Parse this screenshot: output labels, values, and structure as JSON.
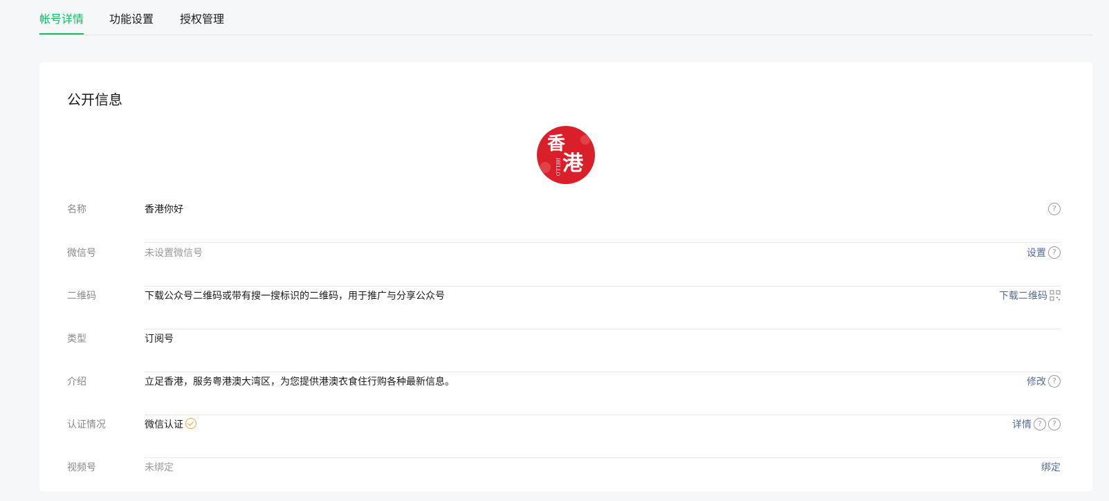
{
  "tabs": [
    {
      "label": "帐号详情"
    },
    {
      "label": "功能设置"
    },
    {
      "label": "授权管理"
    }
  ],
  "section": {
    "title": "公开信息",
    "avatar_text_top": "香",
    "avatar_text_bottom": "港",
    "avatar_text_side": "HELLO"
  },
  "rows": {
    "name": {
      "label": "名称",
      "value": "香港你好"
    },
    "wechat_id": {
      "label": "微信号",
      "value": "未设置微信号",
      "action": "设置"
    },
    "qrcode": {
      "label": "二维码",
      "value": "下载公众号二维码或带有搜一搜标识的二维码，用于推广与分享公众号",
      "action": "下载二维码"
    },
    "type": {
      "label": "类型",
      "value": "订阅号"
    },
    "intro": {
      "label": "介绍",
      "value": "立足香港，服务粤港澳大湾区，为您提供港澳衣食住行购各种最新信息。",
      "action": "修改"
    },
    "verify": {
      "label": "认证情况",
      "value": "微信认证",
      "action": "详情"
    },
    "channels": {
      "label": "视频号",
      "value": "未绑定",
      "action": "绑定"
    }
  },
  "icons": {
    "help": "?",
    "help_icon": "question-circle-icon",
    "qr_icon": "qrcode-icon",
    "verified_icon": "check-circle-icon"
  },
  "colors": {
    "accent": "#07c160",
    "link": "#576b95",
    "verified": "#fa9d3b",
    "avatar_bg": "#d9202a"
  }
}
